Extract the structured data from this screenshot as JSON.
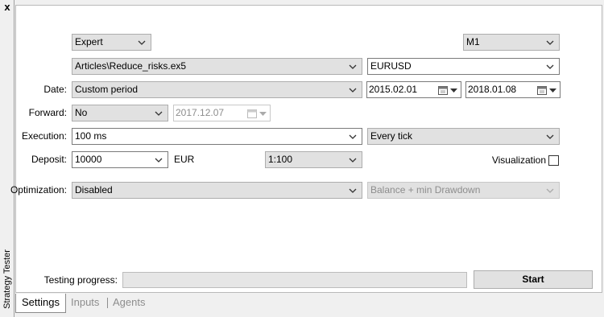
{
  "window": {
    "side_title": "Strategy Tester",
    "close_label": "x"
  },
  "settings": {
    "program_type": "Expert",
    "timeframe": "M1",
    "expert_file": "Articles\\Reduce_risks.ex5",
    "symbol": "EURUSD",
    "date_label": "Date:",
    "date_mode": "Custom period",
    "date_from": "2015.02.01",
    "date_to": "2018.01.08",
    "forward_label": "Forward:",
    "forward_mode": "No",
    "forward_date": "2017.12.07",
    "execution_label": "Execution:",
    "execution_delay": "100 ms",
    "tick_mode": "Every tick",
    "deposit_label": "Deposit:",
    "deposit_amount": "10000",
    "currency": "EUR",
    "leverage": "1:100",
    "visualization_label": "Visualization",
    "visualization_checked": false,
    "optimization_label": "Optimization:",
    "optimization_mode": "Disabled",
    "optimization_criterion": "Balance + min Drawdown"
  },
  "progress": {
    "label": "Testing progress:",
    "value": 0
  },
  "start_button": "Start",
  "tabs": [
    {
      "label": "Settings",
      "active": true
    },
    {
      "label": "Inputs",
      "active": false
    },
    {
      "label": "Agents",
      "active": false
    }
  ]
}
